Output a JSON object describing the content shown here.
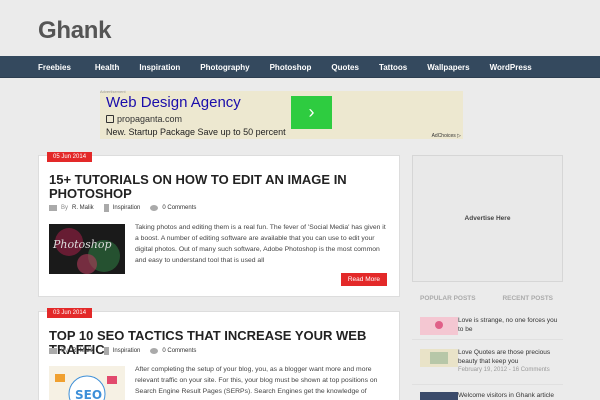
{
  "site": {
    "logo": "Ghank"
  },
  "nav": {
    "items": [
      "Freebies",
      "Health",
      "Inspiration",
      "Photography",
      "Photoshop",
      "Quotes",
      "Tattoos",
      "Wallpapers",
      "WordPress"
    ]
  },
  "ad": {
    "label": "Advertisement",
    "headline": "Web Design Agency",
    "domain": "propaganta.com",
    "description": "New. Startup Package Save up to 50 percent",
    "cta_arrow": "›",
    "adchoices": "AdChoices ▷"
  },
  "posts": [
    {
      "date": "05 Jun 2014",
      "title": "15+ TUTORIALS ON HOW TO EDIT AN IMAGE IN PHOTOSHOP",
      "author_prefix": "By",
      "author": "R. Malik",
      "category": "Inspiration",
      "comments": "0 Comments",
      "excerpt": "Taking photos and editing them is a real fun. The fever of 'Social Media' has given it a boost. A number of editing software are available that you can use to edit your digital photos. Out of many such software, Adobe Photoshop is the most common and easy to understand tool that is used all",
      "read_more": "Read More",
      "thumb_text": "Photoshop"
    },
    {
      "date": "03 Jun 2014",
      "title": "TOP 10 SEO TACTICS THAT INCREASE YOUR WEB TRAFFIC:",
      "author_prefix": "By",
      "author": "R. Malik",
      "category": "Inspiration",
      "comments": "0 Comments",
      "excerpt": "After completing the setup of your blog, you, as a blogger want more and more relevant traffic on your site. For this, your blog must be shown at top positions on Search Engine Result Pages (SERPs). Search Engines get the knowledge of",
      "thumb_text": "SEO"
    }
  ],
  "sidebar": {
    "advertise": "Advertise Here",
    "tabs": [
      "POPULAR POSTS",
      "RECENT POSTS"
    ],
    "items": [
      {
        "text": "Love is strange, no one forces you to be",
        "date": ""
      },
      {
        "text": "Love Quotes are those precious beauty that keep you",
        "date": "February 19, 2012 - 16 Comments"
      },
      {
        "text": "Welcome visitors in Ghank article",
        "date": ""
      }
    ]
  },
  "colors": {
    "nav": "#34495e",
    "accent": "#e32929",
    "ad_green": "#2ecc40"
  }
}
